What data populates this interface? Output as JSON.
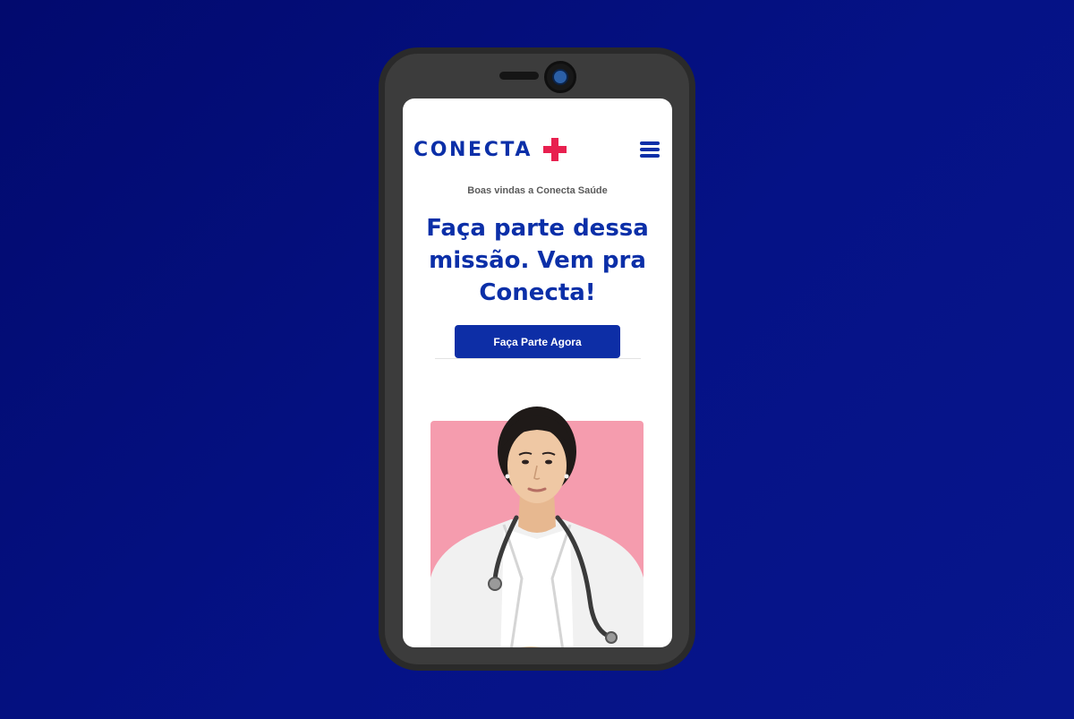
{
  "logo": {
    "text": "CONECTA",
    "accent_color": "#e8204f",
    "brand_color": "#0b2fa8"
  },
  "header": {
    "menu_icon": "hamburger-menu-icon"
  },
  "hero": {
    "welcome": "Boas vindas a Conecta Saúde",
    "headline": "Faça parte dessa missão. Vem pra Conecta!",
    "cta_label": "Faça Parte Agora"
  },
  "image": {
    "subject": "doctor-photo",
    "background_color": "#f59cae"
  },
  "colors": {
    "page_background": "#040f80",
    "phone_frame": "#3c3c3c",
    "button": "#0d2ea6"
  }
}
